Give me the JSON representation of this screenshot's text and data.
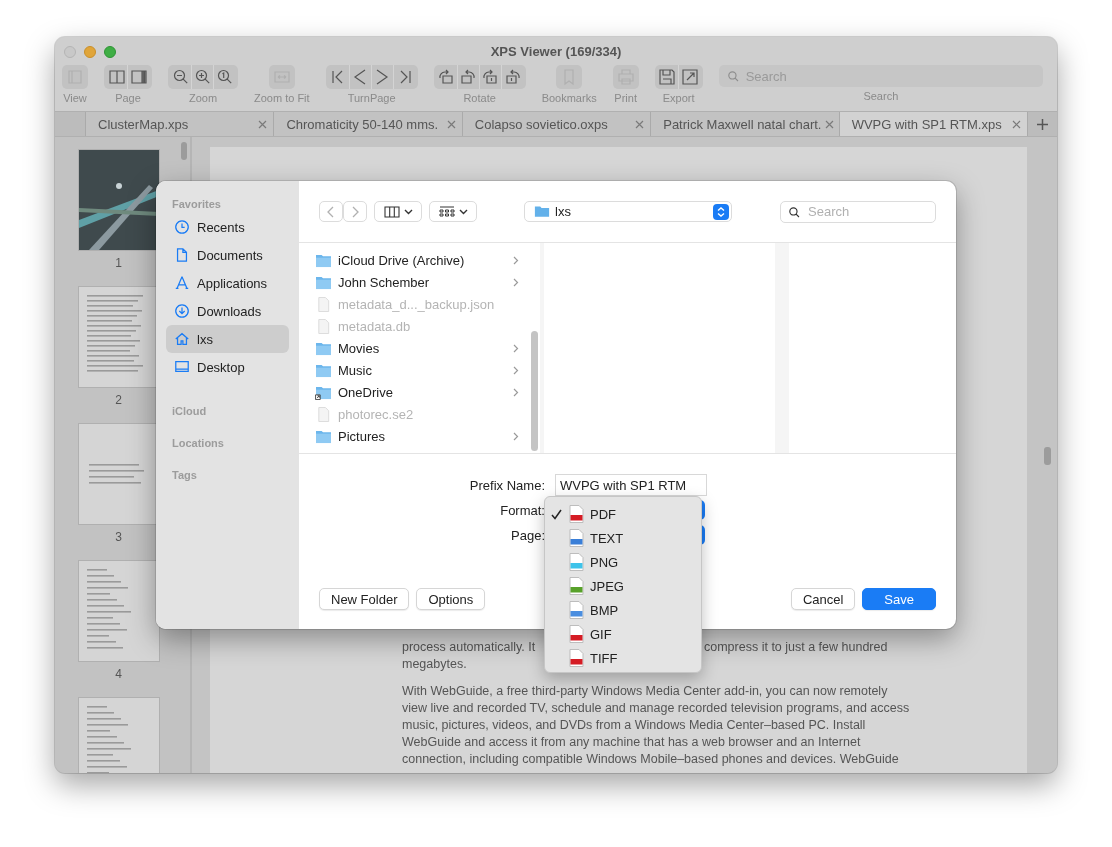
{
  "window": {
    "title": "XPS Viewer (169/334)"
  },
  "toolbar": {
    "groups": [
      {
        "label": "View",
        "disabled": true
      },
      {
        "label": "Page",
        "disabled": false
      },
      {
        "label": "Zoom",
        "disabled": false
      },
      {
        "label": "Zoom to Fit",
        "disabled": true
      },
      {
        "label": "TurnPage",
        "disabled": false
      },
      {
        "label": "Rotate",
        "disabled": false
      },
      {
        "label": "Bookmarks",
        "disabled": true
      },
      {
        "label": "Print",
        "disabled": true
      },
      {
        "label": "Export",
        "disabled": false
      }
    ],
    "search": {
      "placeholder": "Search",
      "label": "Search"
    }
  },
  "tabs": [
    {
      "label": "ClusterMap.xps",
      "selected": false
    },
    {
      "label": "Chromaticity 50-140 mms.",
      "selected": false
    },
    {
      "label": "Colapso sovietico.oxps",
      "selected": false
    },
    {
      "label": "Patrick Maxwell natal chart.",
      "selected": false
    },
    {
      "label": "WVPG with SP1 RTM.xps",
      "selected": true
    }
  ],
  "thumbnails": [
    {
      "kind": "cover",
      "label": "1"
    },
    {
      "kind": "text",
      "label": "2"
    },
    {
      "kind": "sparse",
      "label": "3"
    },
    {
      "kind": "list",
      "label": "4"
    },
    {
      "kind": "list"
    }
  ],
  "document": {
    "paragraphs": [
      [
        [
          "process automatically. It",
          "compress it to just a few hundred"
        ],
        [
          "megabytes."
        ]
      ],
      [
        [
          "With WebGuide, a free third-party Windows Media Center add-in, you can now remotely"
        ],
        [
          "view live and recorded TV, schedule and manage recorded television programs, and access"
        ],
        [
          "music, pictures, videos, and DVDs from a Windows Media Center–based PC. Install"
        ],
        [
          "WebGuide and access it from any machine that has a web browser and an Internet"
        ],
        [
          "connection, including compatible Windows Mobile–based phones and devices. WebGuide"
        ]
      ]
    ]
  },
  "save_dialog": {
    "sidebar": [
      {
        "heading": "Favorites",
        "items": [
          {
            "label": "Recents",
            "kind": "recents",
            "selected": false
          },
          {
            "label": "Documents",
            "kind": "documents",
            "selected": false
          },
          {
            "label": "Applications",
            "kind": "applications",
            "selected": false
          },
          {
            "label": "Downloads",
            "kind": "downloads",
            "selected": false
          },
          {
            "label": "lxs",
            "kind": "home",
            "selected": true
          },
          {
            "label": "Desktop",
            "kind": "desktop",
            "selected": false
          }
        ]
      },
      {
        "heading": "iCloud"
      },
      {
        "heading": "Locations"
      },
      {
        "heading": "Tags"
      }
    ],
    "location": "lxs",
    "search_placeholder": "Search",
    "files": [
      {
        "name": "iCloud Drive (Archive)",
        "kind": "folder",
        "disabled": false
      },
      {
        "name": "John Schember",
        "kind": "folder",
        "disabled": false
      },
      {
        "name": "metadata_d..._backup.json",
        "kind": "file",
        "disabled": true
      },
      {
        "name": "metadata.db",
        "kind": "file",
        "disabled": true
      },
      {
        "name": "Movies",
        "kind": "folder",
        "disabled": false
      },
      {
        "name": "Music",
        "kind": "folder",
        "disabled": false
      },
      {
        "name": "OneDrive",
        "kind": "alias",
        "disabled": false
      },
      {
        "name": "photorec.se2",
        "kind": "file",
        "disabled": true
      },
      {
        "name": "Pictures",
        "kind": "folder",
        "disabled": false
      }
    ],
    "prefix_label": "Prefix Name:",
    "prefix_value": "WVPG with SP1 RTM",
    "format_label": "Format:",
    "page_label": "Page:",
    "left_buttons": [
      {
        "label": "New Folder",
        "kind": "plain"
      },
      {
        "label": "Options",
        "kind": "plain"
      }
    ],
    "right_buttons": [
      {
        "label": "Cancel",
        "kind": "plain"
      },
      {
        "label": "Save",
        "kind": "default"
      }
    ],
    "format_menu": [
      {
        "label": "PDF",
        "selected": true,
        "color": "#d51c24"
      },
      {
        "label": "TEXT",
        "selected": false,
        "color": "#3a7fd8"
      },
      {
        "label": "PNG",
        "selected": false,
        "color": "#3ec3ea"
      },
      {
        "label": "JPEG",
        "selected": false,
        "color": "#58a12a"
      },
      {
        "label": "BMP",
        "selected": false,
        "color": "#4a8ee0"
      },
      {
        "label": "GIF",
        "selected": false,
        "color": "#d51c24"
      },
      {
        "label": "TIFF",
        "selected": false,
        "color": "#d51c24"
      }
    ]
  }
}
